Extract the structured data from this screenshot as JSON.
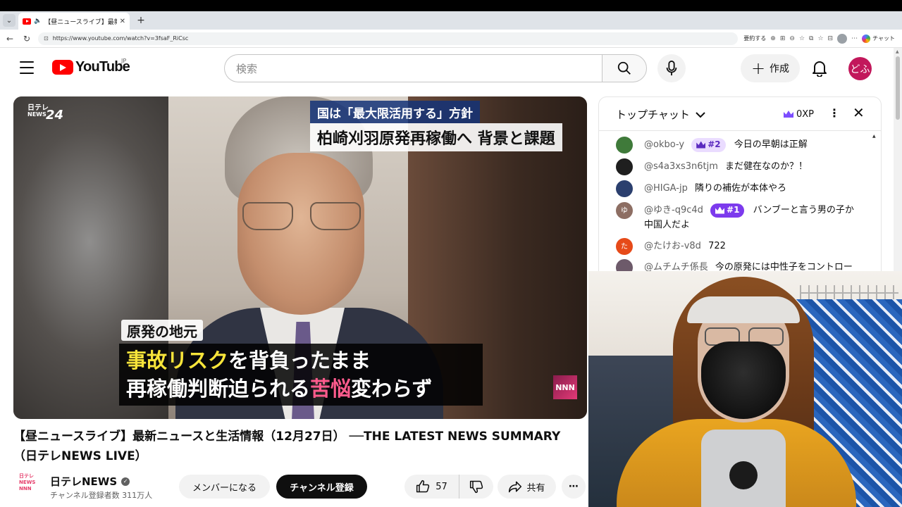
{
  "browser": {
    "tab_title": "【昼ニュースライブ】最新ニュースと生",
    "url": "https://www.youtube.com/watch?v=3fsaF_RiCsc",
    "summarize_label": "要約する",
    "chat_label": "チャット"
  },
  "masthead": {
    "logo_text": "YouTube",
    "region": "JP",
    "search_placeholder": "検索",
    "create_label": "作成",
    "avatar_text": "どふ"
  },
  "video": {
    "ntv_logo_line1": "日テレ",
    "ntv_logo_line2": "NEWS",
    "ntv_logo_num": "24",
    "caption_top1": "国は「最大限活用する」方針",
    "caption_top2": "柏崎刈羽原発再稼働へ 背景と課題",
    "caption_tag": "原発の地元",
    "caption_line1_a": "事故リスク",
    "caption_line1_b": "を背負ったまま",
    "caption_line2_a": "再稼働判断迫られる",
    "caption_line2_b": "苦悩",
    "caption_line2_c": "変わらず",
    "corner_logo": "NNN"
  },
  "title": "【昼ニュースライブ】最新ニュースと生活情報（12月27日） ──THE LATEST NEWS SUMMARY（日テレNEWS LIVE）",
  "channel": {
    "avatar_text": "日テレ NEWS NNN",
    "name": "日テレNEWS",
    "subscribers": "チャンネル登録者数 311万人",
    "member_label": "メンバーになる",
    "subscribe_label": "チャンネル登録"
  },
  "actions": {
    "like_count": "57",
    "share_label": "共有"
  },
  "chat": {
    "header_title": "トップチャット",
    "xp_label": "0XP",
    "messages": [
      {
        "avatar": "",
        "avatar_color": "#3f7a3a",
        "author": "@okbo-y",
        "badge": "#2",
        "badge_style": "light",
        "text": "今日の早朝は正解"
      },
      {
        "avatar": "",
        "avatar_color": "#1f1f1f",
        "author": "@s4a3xs3n6tjm",
        "badge": "",
        "badge_style": "",
        "text": "まだ健在なのか？！"
      },
      {
        "avatar": "",
        "avatar_color": "#2b3f6e",
        "author": "@HIGA-jp",
        "badge": "",
        "badge_style": "",
        "text": "隣りの補佐が本体やろ"
      },
      {
        "avatar": "ゆ",
        "avatar_color": "#8d6e63",
        "author": "@ゆき-q9c4d",
        "badge": "#1",
        "badge_style": "dark",
        "text": "バンブーと言う男の子か中国人だよ"
      },
      {
        "avatar": "た",
        "avatar_color": "#e64a19",
        "author": "@たけお-v8d",
        "badge": "",
        "badge_style": "",
        "text": "722"
      },
      {
        "avatar": "",
        "avatar_color": "#6d5a6a",
        "author": "@ムチムチ係長",
        "badge": "",
        "badge_style": "",
        "text": "今の原発には中性子をコントロー"
      }
    ]
  }
}
